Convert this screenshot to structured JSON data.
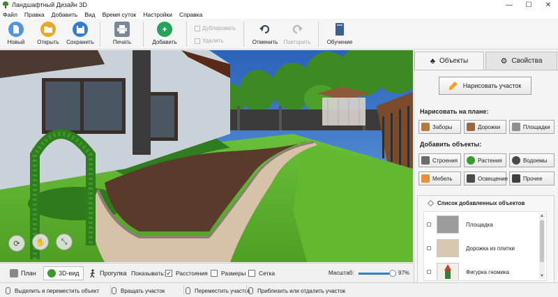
{
  "window": {
    "title": "Ландшафтный Дизайн 3D",
    "controls": [
      "—",
      "☐",
      "✕"
    ]
  },
  "menu": [
    "Файл",
    "Правка",
    "Добавить",
    "Вид",
    "Время суток",
    "Настройки",
    "Справка"
  ],
  "toolbar": {
    "new_label": "Новый",
    "open_label": "Открыть",
    "save_label": "Сохранить",
    "print_label": "Печать",
    "add_label": "Добавить",
    "duplicate_label": "Дублировать",
    "delete_label": "Удалить",
    "undo_label": "Отменить",
    "redo_label": "Повторить",
    "training_label": "Обучение"
  },
  "panel": {
    "tabs": [
      {
        "label": "Объекты",
        "icon": "tree-icon",
        "active": true
      },
      {
        "label": "Свойства",
        "icon": "gear-icon",
        "active": false
      }
    ],
    "draw_plot_label": "Нарисовать участок",
    "draw_on_plan_title": "Нарисовать на плане:",
    "draw_buttons": [
      {
        "label": "Заборы",
        "icon": "fence-icon",
        "color": "#b57a3c"
      },
      {
        "label": "Дорожки",
        "icon": "path-icon",
        "color": "#9a6b43"
      },
      {
        "label": "Площадки",
        "icon": "platform-icon",
        "color": "#8f8f8f"
      }
    ],
    "add_objects_title": "Добавить объекты:",
    "add_buttons": [
      {
        "label": "Строения",
        "icon": "building-icon",
        "color": "#6c6c6c"
      },
      {
        "label": "Растения",
        "icon": "plant-icon",
        "color": "#3c9a2c"
      },
      {
        "label": "Водоемы",
        "icon": "pond-icon",
        "color": "#4a4a4a"
      },
      {
        "label": "Мебель",
        "icon": "furniture-icon",
        "color": "#e8913a"
      },
      {
        "label": "Освещение",
        "icon": "lighting-icon",
        "color": "#4b4b4b"
      },
      {
        "label": "Прочее",
        "icon": "misc-icon",
        "color": "#3f3f3f"
      }
    ],
    "objects_list_title": "Список добавленных объектов",
    "objects": [
      {
        "label": "Площадка",
        "thumb_color": "#9c9c9c"
      },
      {
        "label": "Дорожка из плитки",
        "thumb_color": "#d8c8b0"
      },
      {
        "label": "Фигурка гномика",
        "thumb_color": "#d23a2a"
      }
    ]
  },
  "viewbar": {
    "tabs": [
      {
        "label": "План",
        "icon": "plan-icon",
        "active": false
      },
      {
        "label": "3D-вид",
        "icon": "tree-3d-icon",
        "active": true
      },
      {
        "label": "Прогулка",
        "icon": "walk-icon",
        "active": false
      }
    ],
    "show_label": "Показывать:",
    "checks": [
      {
        "label": "Расстояния",
        "checked": true
      },
      {
        "label": "Размеры",
        "checked": false
      },
      {
        "label": "Сетка",
        "checked": false
      }
    ],
    "zoom_label": "Масштаб:",
    "zoom_value": "97%",
    "zoom_fraction": 0.97
  },
  "status": [
    "Выделить и переместить объект",
    "Вращать участок",
    "Переместить участок",
    "Приблизить или отдалить участок"
  ],
  "colors": {
    "accent_blue": "#2f7fd1",
    "accent_green": "#25a35a",
    "sky": "#2f6ec0",
    "lawn": "#5fae2f",
    "soil": "#5a3a2a",
    "tile_path": "#d6c2a6"
  }
}
